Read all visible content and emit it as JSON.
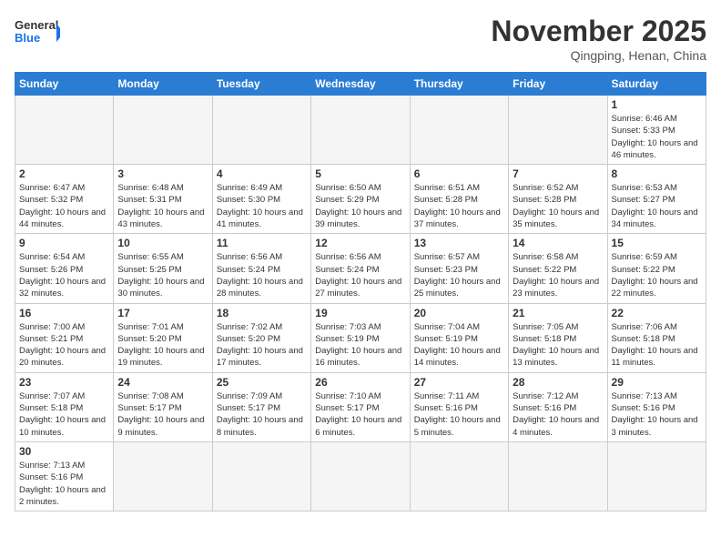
{
  "logo": {
    "text_general": "General",
    "text_blue": "Blue"
  },
  "title": "November 2025",
  "subtitle": "Qingping, Henan, China",
  "days_header": [
    "Sunday",
    "Monday",
    "Tuesday",
    "Wednesday",
    "Thursday",
    "Friday",
    "Saturday"
  ],
  "weeks": [
    [
      {
        "day": "",
        "info": ""
      },
      {
        "day": "",
        "info": ""
      },
      {
        "day": "",
        "info": ""
      },
      {
        "day": "",
        "info": ""
      },
      {
        "day": "",
        "info": ""
      },
      {
        "day": "",
        "info": ""
      },
      {
        "day": "1",
        "info": "Sunrise: 6:46 AM\nSunset: 5:33 PM\nDaylight: 10 hours\nand 46 minutes."
      }
    ],
    [
      {
        "day": "2",
        "info": "Sunrise: 6:47 AM\nSunset: 5:32 PM\nDaylight: 10 hours\nand 44 minutes."
      },
      {
        "day": "3",
        "info": "Sunrise: 6:48 AM\nSunset: 5:31 PM\nDaylight: 10 hours\nand 43 minutes."
      },
      {
        "day": "4",
        "info": "Sunrise: 6:49 AM\nSunset: 5:30 PM\nDaylight: 10 hours\nand 41 minutes."
      },
      {
        "day": "5",
        "info": "Sunrise: 6:50 AM\nSunset: 5:29 PM\nDaylight: 10 hours\nand 39 minutes."
      },
      {
        "day": "6",
        "info": "Sunrise: 6:51 AM\nSunset: 5:28 PM\nDaylight: 10 hours\nand 37 minutes."
      },
      {
        "day": "7",
        "info": "Sunrise: 6:52 AM\nSunset: 5:28 PM\nDaylight: 10 hours\nand 35 minutes."
      },
      {
        "day": "8",
        "info": "Sunrise: 6:53 AM\nSunset: 5:27 PM\nDaylight: 10 hours\nand 34 minutes."
      }
    ],
    [
      {
        "day": "9",
        "info": "Sunrise: 6:54 AM\nSunset: 5:26 PM\nDaylight: 10 hours\nand 32 minutes."
      },
      {
        "day": "10",
        "info": "Sunrise: 6:55 AM\nSunset: 5:25 PM\nDaylight: 10 hours\nand 30 minutes."
      },
      {
        "day": "11",
        "info": "Sunrise: 6:56 AM\nSunset: 5:24 PM\nDaylight: 10 hours\nand 28 minutes."
      },
      {
        "day": "12",
        "info": "Sunrise: 6:56 AM\nSunset: 5:24 PM\nDaylight: 10 hours\nand 27 minutes."
      },
      {
        "day": "13",
        "info": "Sunrise: 6:57 AM\nSunset: 5:23 PM\nDaylight: 10 hours\nand 25 minutes."
      },
      {
        "day": "14",
        "info": "Sunrise: 6:58 AM\nSunset: 5:22 PM\nDaylight: 10 hours\nand 23 minutes."
      },
      {
        "day": "15",
        "info": "Sunrise: 6:59 AM\nSunset: 5:22 PM\nDaylight: 10 hours\nand 22 minutes."
      }
    ],
    [
      {
        "day": "16",
        "info": "Sunrise: 7:00 AM\nSunset: 5:21 PM\nDaylight: 10 hours\nand 20 minutes."
      },
      {
        "day": "17",
        "info": "Sunrise: 7:01 AM\nSunset: 5:20 PM\nDaylight: 10 hours\nand 19 minutes."
      },
      {
        "day": "18",
        "info": "Sunrise: 7:02 AM\nSunset: 5:20 PM\nDaylight: 10 hours\nand 17 minutes."
      },
      {
        "day": "19",
        "info": "Sunrise: 7:03 AM\nSunset: 5:19 PM\nDaylight: 10 hours\nand 16 minutes."
      },
      {
        "day": "20",
        "info": "Sunrise: 7:04 AM\nSunset: 5:19 PM\nDaylight: 10 hours\nand 14 minutes."
      },
      {
        "day": "21",
        "info": "Sunrise: 7:05 AM\nSunset: 5:18 PM\nDaylight: 10 hours\nand 13 minutes."
      },
      {
        "day": "22",
        "info": "Sunrise: 7:06 AM\nSunset: 5:18 PM\nDaylight: 10 hours\nand 11 minutes."
      }
    ],
    [
      {
        "day": "23",
        "info": "Sunrise: 7:07 AM\nSunset: 5:18 PM\nDaylight: 10 hours\nand 10 minutes."
      },
      {
        "day": "24",
        "info": "Sunrise: 7:08 AM\nSunset: 5:17 PM\nDaylight: 10 hours\nand 9 minutes."
      },
      {
        "day": "25",
        "info": "Sunrise: 7:09 AM\nSunset: 5:17 PM\nDaylight: 10 hours\nand 8 minutes."
      },
      {
        "day": "26",
        "info": "Sunrise: 7:10 AM\nSunset: 5:17 PM\nDaylight: 10 hours\nand 6 minutes."
      },
      {
        "day": "27",
        "info": "Sunrise: 7:11 AM\nSunset: 5:16 PM\nDaylight: 10 hours\nand 5 minutes."
      },
      {
        "day": "28",
        "info": "Sunrise: 7:12 AM\nSunset: 5:16 PM\nDaylight: 10 hours\nand 4 minutes."
      },
      {
        "day": "29",
        "info": "Sunrise: 7:13 AM\nSunset: 5:16 PM\nDaylight: 10 hours\nand 3 minutes."
      }
    ],
    [
      {
        "day": "30",
        "info": "Sunrise: 7:13 AM\nSunset: 5:16 PM\nDaylight: 10 hours\nand 2 minutes."
      },
      {
        "day": "",
        "info": ""
      },
      {
        "day": "",
        "info": ""
      },
      {
        "day": "",
        "info": ""
      },
      {
        "day": "",
        "info": ""
      },
      {
        "day": "",
        "info": ""
      },
      {
        "day": "",
        "info": ""
      }
    ]
  ]
}
